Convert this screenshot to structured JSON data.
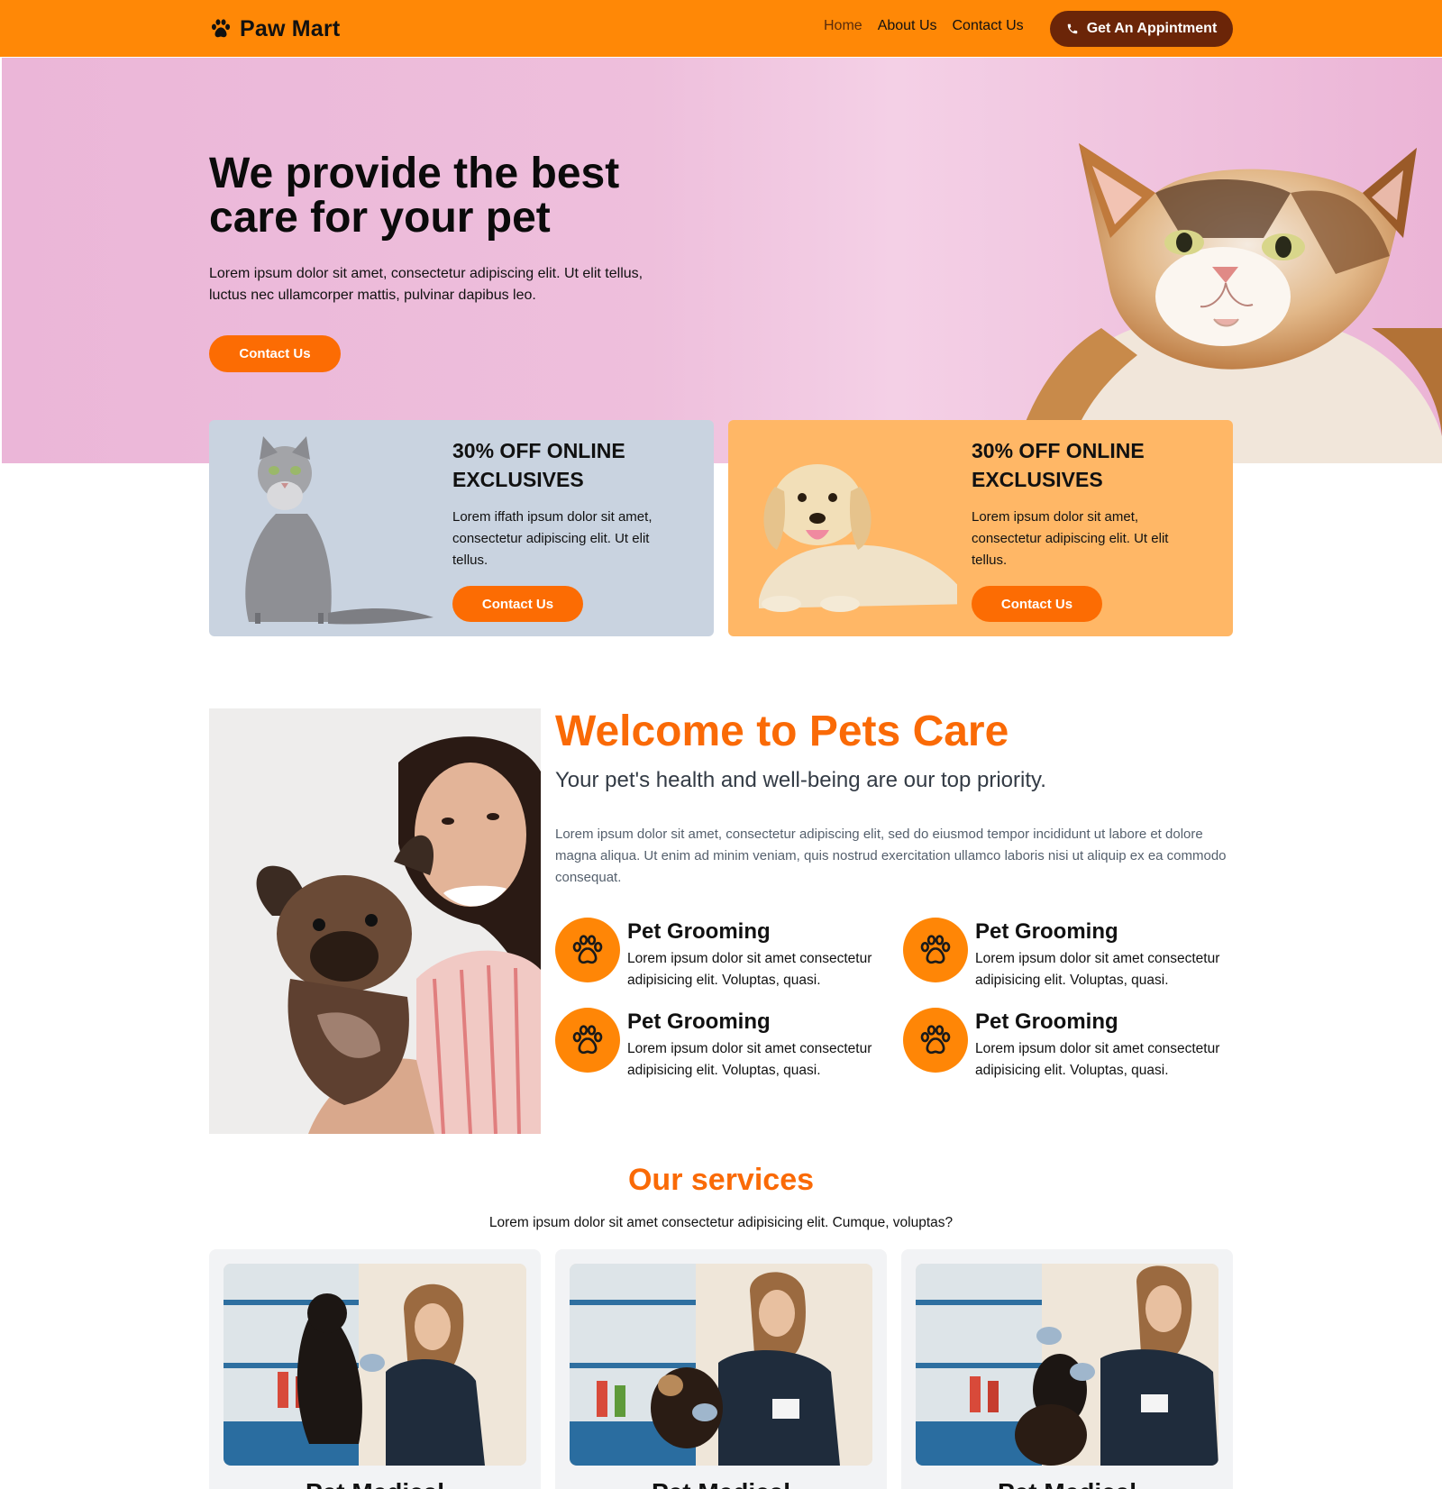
{
  "brand": {
    "name": "Paw Mart",
    "accent": "#ff8806",
    "button_orange": "#fc6c03",
    "button_dark": "#6b2508"
  },
  "nav": {
    "links": [
      {
        "label": "Home",
        "active": true
      },
      {
        "label": "About Us",
        "active": false
      },
      {
        "label": "Contact Us",
        "active": false
      }
    ],
    "cta_label": "Get An Appintment",
    "cta_icon": "phone-icon"
  },
  "hero": {
    "title": "We provide the best care for your pet",
    "text": "Lorem ipsum dolor sit amet, consectetur adipiscing elit. Ut elit tellus, luctus nec ullamcorper mattis, pulvinar dapibus leo.",
    "button_label": "Contact Us"
  },
  "promos": [
    {
      "title": "30% OFF ONLINE EXCLUSIVES",
      "text": "Lorem iffath ipsum dolor sit amet, consectetur adipiscing elit. Ut elit tellus.",
      "button_label": "Contact Us",
      "image": "cat-photo"
    },
    {
      "title": "30% OFF ONLINE EXCLUSIVES",
      "text": "Lorem ipsum dolor sit amet, consectetur adipiscing elit. Ut elit tellus.",
      "button_label": "Contact Us",
      "image": "puppy-photo"
    }
  ],
  "welcome": {
    "title": "Welcome to Pets Care",
    "subtitle": "Your pet's health and well-being are our top priority.",
    "text": "Lorem ipsum dolor sit amet, consectetur adipiscing elit, sed do eiusmod tempor incididunt ut labore et dolore magna aliqua. Ut enim ad minim veniam, quis nostrud exercitation ullamco laboris nisi ut aliquip ex ea commodo consequat.",
    "features": [
      {
        "title": "Pet Grooming",
        "text": "Lorem ipsum dolor sit amet consectetur adipisicing elit. Voluptas, quasi.",
        "icon": "paw-icon"
      },
      {
        "title": "Pet Grooming",
        "text": "Lorem ipsum dolor sit amet consectetur adipisicing elit. Voluptas, quasi.",
        "icon": "paw-icon"
      },
      {
        "title": "Pet Grooming",
        "text": "Lorem ipsum dolor sit amet consectetur adipisicing elit. Voluptas, quasi.",
        "icon": "paw-icon"
      },
      {
        "title": "Pet Grooming",
        "text": "Lorem ipsum dolor sit amet consectetur adipisicing elit. Voluptas, quasi.",
        "icon": "paw-icon"
      }
    ]
  },
  "services": {
    "title": "Our services",
    "text": "Lorem ipsum dolor sit amet consectetur adipisicing elit. Cumque, voluptas?",
    "cards": [
      {
        "title": "Pet Medical"
      },
      {
        "title": "Pet Medical"
      },
      {
        "title": "Pet Medical"
      }
    ]
  }
}
